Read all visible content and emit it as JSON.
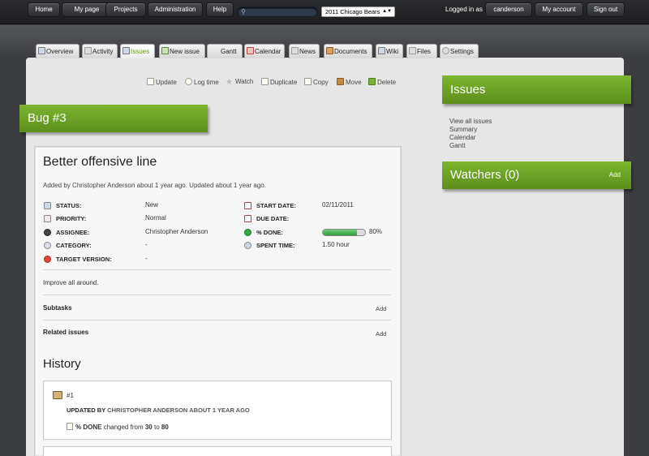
{
  "topbar": {
    "home": "Home",
    "my_page": "My page",
    "projects": "Projects",
    "administration": "Administration",
    "help": "Help",
    "project_select": "2011 Chicago Bears",
    "logged_in_as": "Logged in as",
    "username": "canderson",
    "my_account": "My account",
    "sign_out": "Sign out"
  },
  "tabs": [
    {
      "label": "Overview"
    },
    {
      "label": "Activity"
    },
    {
      "label": "Issues",
      "active": true
    },
    {
      "label": "New issue"
    },
    {
      "label": "Gantt"
    },
    {
      "label": "Calendar"
    },
    {
      "label": "News"
    },
    {
      "label": "Documents"
    },
    {
      "label": "Wiki"
    },
    {
      "label": "Files"
    },
    {
      "label": "Settings"
    }
  ],
  "actions": {
    "update": "Update",
    "log_time": "Log time",
    "watch": "Watch",
    "duplicate": "Duplicate",
    "copy": "Copy",
    "move": "Move",
    "delete": "Delete"
  },
  "issue": {
    "heading": "Bug #3",
    "title": "Better offensive line",
    "added_prefix": "Added by",
    "author": "Christopher Anderson",
    "added_time": "about 1 year",
    "ago_updated": "ago. Updated",
    "updated_time": "about 1 year",
    "ago": "ago.",
    "status_label": "STATUS:",
    "status": "New",
    "priority_label": "PRIORITY:",
    "priority": "Normal",
    "assignee_label": "ASSIGNEE:",
    "assignee": "Christopher Anderson",
    "category_label": "CATEGORY:",
    "category": "-",
    "target_label": "TARGET VERSION:",
    "target": "-",
    "start_label": "START DATE:",
    "start": "02/11/2011",
    "due_label": "DUE DATE:",
    "done_label": "% DONE:",
    "done_text": "80%",
    "done_value": 0.8,
    "spent_label": "SPENT TIME:",
    "spent": "1.50 hour",
    "description": "Improve all around.",
    "subtasks": "Subtasks",
    "related": "Related issues",
    "add": "Add"
  },
  "history": {
    "title": "History",
    "entry_num": "#1",
    "updated_by": "UPDATED BY",
    "author": "CHRISTOPHER ANDERSON",
    "time": "ABOUT 1 YEAR AGO",
    "field": "% DONE",
    "changed_from": "changed from",
    "from": "30",
    "to_word": "to",
    "to": "80"
  },
  "sidebar": {
    "issues_title": "Issues",
    "links": [
      "View all issues",
      "Summary",
      "Calendar",
      "Gantt"
    ],
    "watchers_title": "Watchers (0)",
    "watchers_add": "Add"
  }
}
